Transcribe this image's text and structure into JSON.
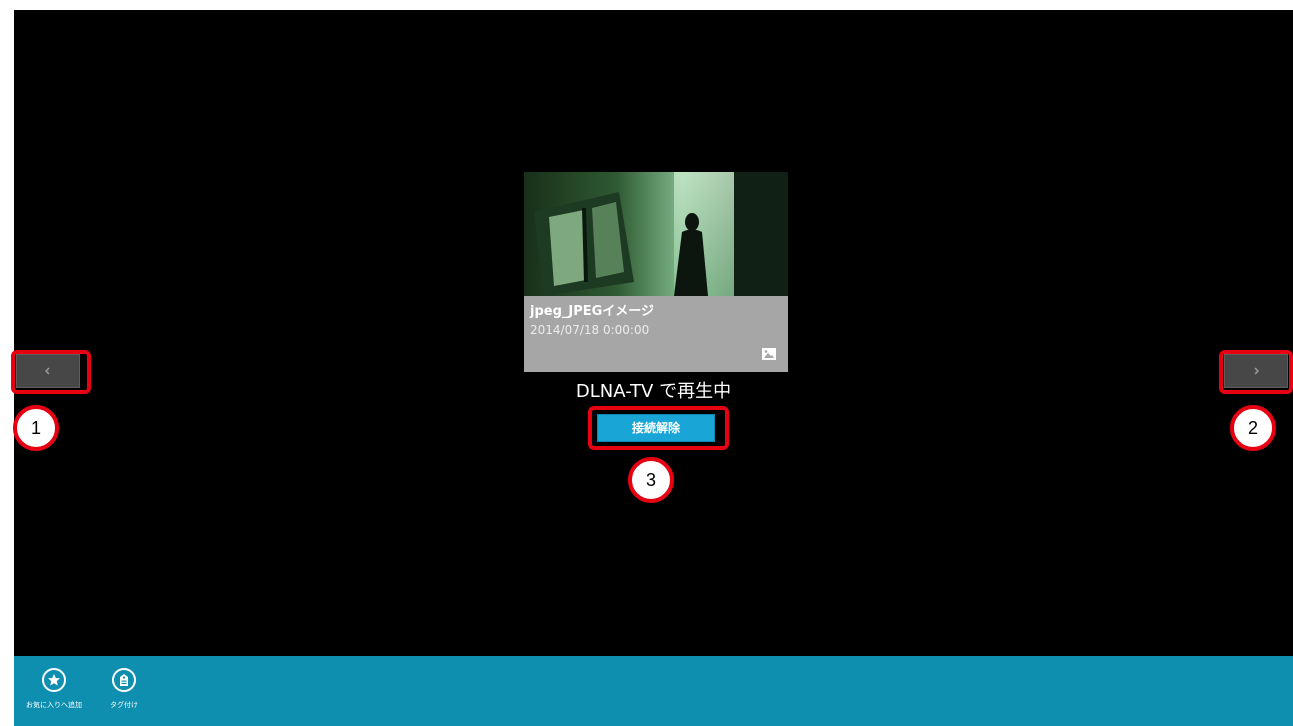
{
  "media": {
    "title": "jpeg_JPEGイメージ",
    "date": "2014/07/18 0:00:00",
    "type_icon": "image-icon"
  },
  "status": {
    "text": "DLNA-TV で再生中"
  },
  "disconnect_button": {
    "label": "接続解除",
    "color": "#19a6d6"
  },
  "navigation": {
    "prev_icon": "chevron-left-icon",
    "next_icon": "chevron-right-icon"
  },
  "app_bar": {
    "color": "#0f8fb0",
    "commands": [
      {
        "label": "お気に入りへ追加",
        "icon": "star-icon"
      },
      {
        "label": "タグ付け",
        "icon": "tag-icon"
      }
    ]
  },
  "callouts": [
    "1",
    "2",
    "3"
  ],
  "colors": {
    "background": "#000000",
    "callout_red": "#e60012"
  }
}
